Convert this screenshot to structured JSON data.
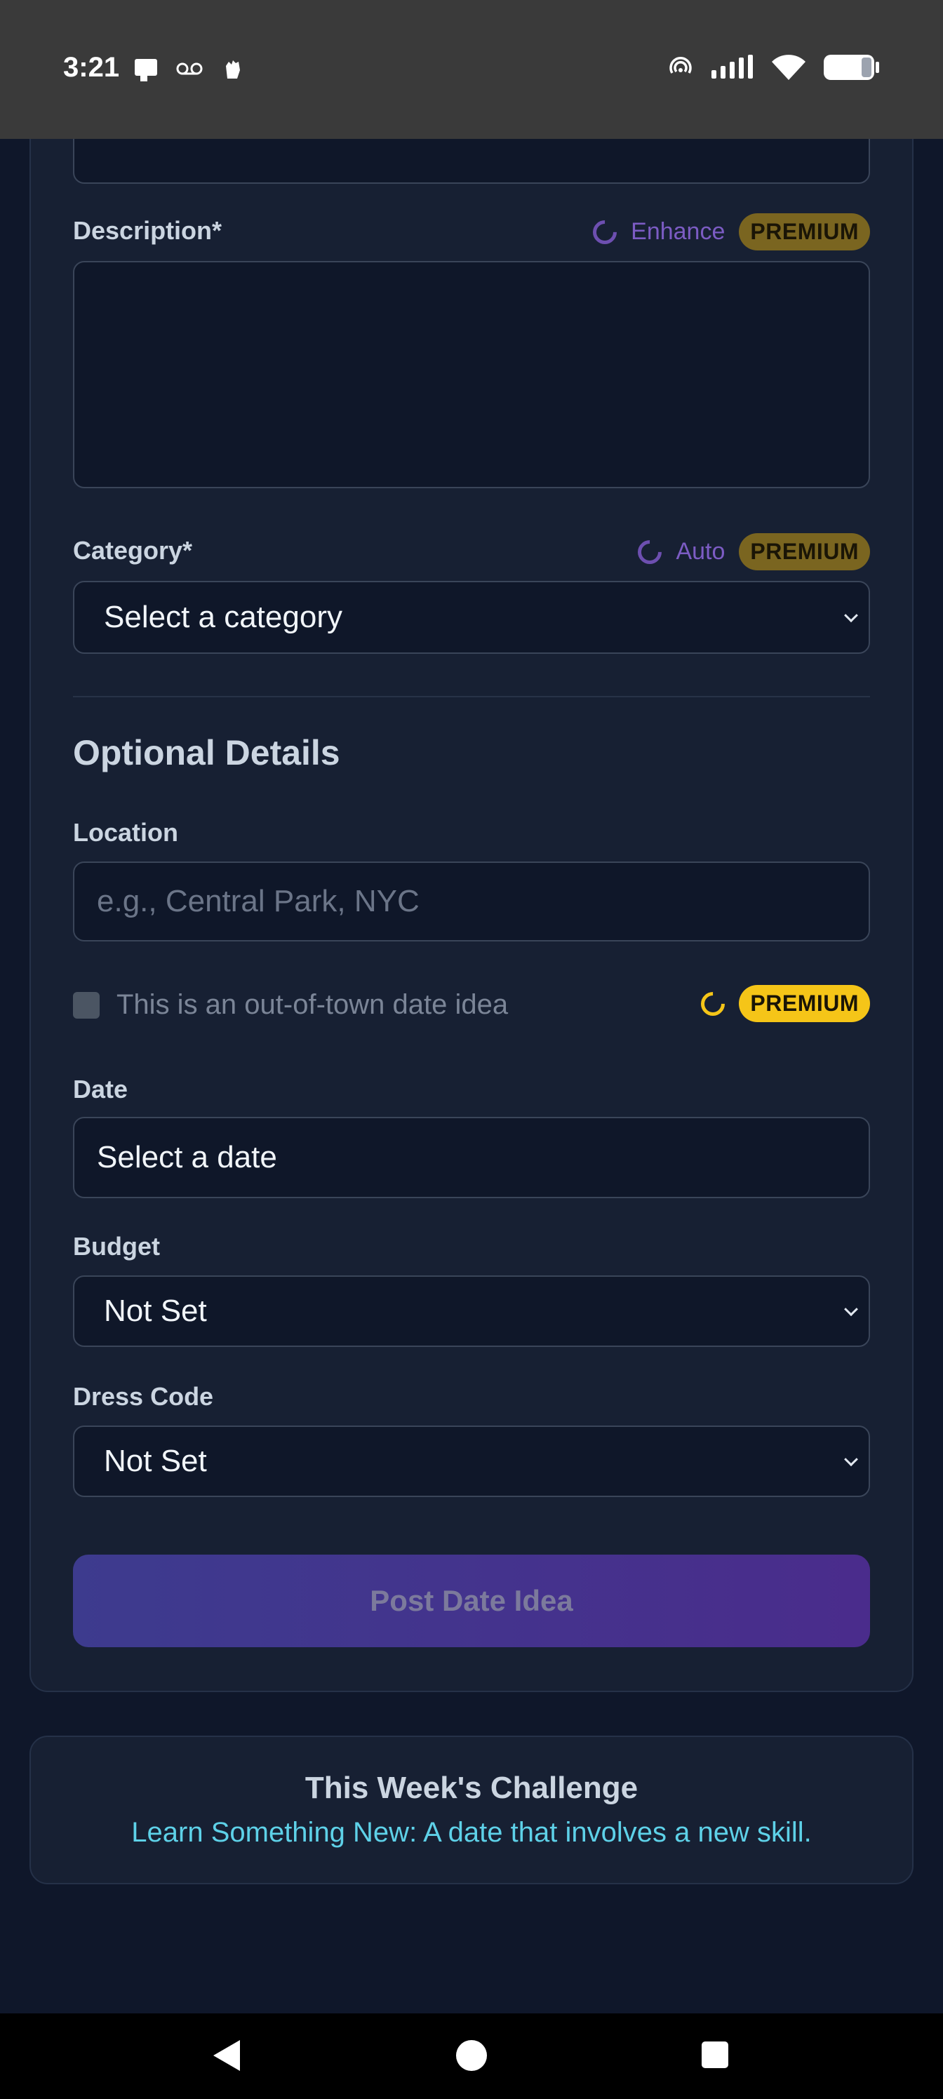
{
  "status_bar": {
    "time": "3:21",
    "left_icons": [
      "card-icon",
      "voicemail-icon",
      "hand-icon"
    ],
    "right_icons": [
      "hotspot-icon",
      "signal-icon",
      "wifi-icon",
      "battery-icon"
    ]
  },
  "form": {
    "description": {
      "label": "Description*",
      "enhance_label": "Enhance",
      "premium_label": "PREMIUM",
      "value": ""
    },
    "category": {
      "label": "Category*",
      "auto_label": "Auto",
      "premium_label": "PREMIUM",
      "selected": "Select a category"
    },
    "optional_details_title": "Optional Details",
    "location": {
      "label": "Location",
      "placeholder": "e.g., Central Park, NYC"
    },
    "out_of_town": {
      "label": "This is an out-of-town date idea",
      "premium_label": "PREMIUM",
      "checked": false
    },
    "date": {
      "label": "Date",
      "value": "Select a date"
    },
    "budget": {
      "label": "Budget",
      "selected": "Not Set"
    },
    "dress_code": {
      "label": "Dress Code",
      "selected": "Not Set"
    },
    "submit_label": "Post Date Idea"
  },
  "challenge": {
    "title": "This Week's Challenge",
    "text": "Learn Something New: A date that involves a new skill."
  },
  "colors": {
    "background": "#0f172a",
    "card": "#172033",
    "premium_muted": "#7a6520",
    "premium_bright": "#f5c518",
    "accent_link": "#5ed1e8",
    "enhance_purple": "#7c5cc4"
  }
}
